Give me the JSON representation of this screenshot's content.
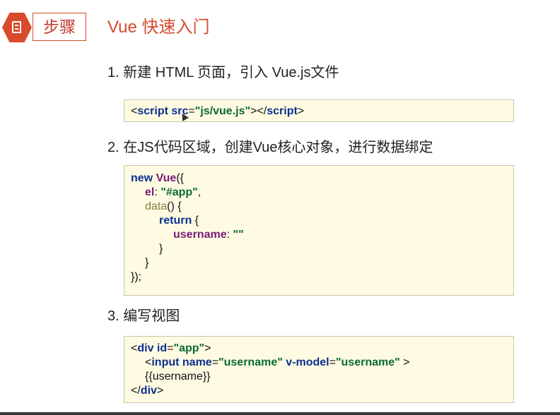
{
  "header": {
    "badge_label": "步骤",
    "title": "Vue 快速入门"
  },
  "steps": [
    {
      "label": "1. 新建 HTML 页面，引入 Vue.js文件"
    },
    {
      "label": "2. 在JS代码区域，创建Vue核心对象，进行数据绑定"
    },
    {
      "label": "3. 编写视图"
    }
  ],
  "code1": {
    "t1": "<",
    "t2": "script",
    "t3": " ",
    "t4": "src",
    "t5": "=",
    "t6": "\"js/vue.js\"",
    "t7": "></",
    "t8": "script",
    "t9": ">"
  },
  "code2": {
    "l1a": "new ",
    "l1b": "Vue",
    "l1c": "({",
    "l2a": "el",
    "l2b": ": ",
    "l2c": "\"#app\"",
    "l2d": ",",
    "l3a": "data",
    "l3b": "() {",
    "l4a": "return",
    "l4b": " {",
    "l5a": "username",
    "l5b": ": ",
    "l5c": "\"\"",
    "l6": "}",
    "l7": "}",
    "l8": "});"
  },
  "code3": {
    "l1a": "<",
    "l1b": "div",
    "l1c": " ",
    "l1d": "id",
    "l1e": "=",
    "l1f": "\"app\"",
    "l1g": ">",
    "l2a": "<",
    "l2b": "input",
    "l2c": " ",
    "l2d": "name",
    "l2e": "=",
    "l2f": "\"username\"",
    "l2g": " ",
    "l2h": "v-model",
    "l2i": "=",
    "l2j": "\"username\"",
    "l2k": " >",
    "l3": "{{username}}",
    "l4a": "</",
    "l4b": "div",
    "l4c": ">"
  }
}
